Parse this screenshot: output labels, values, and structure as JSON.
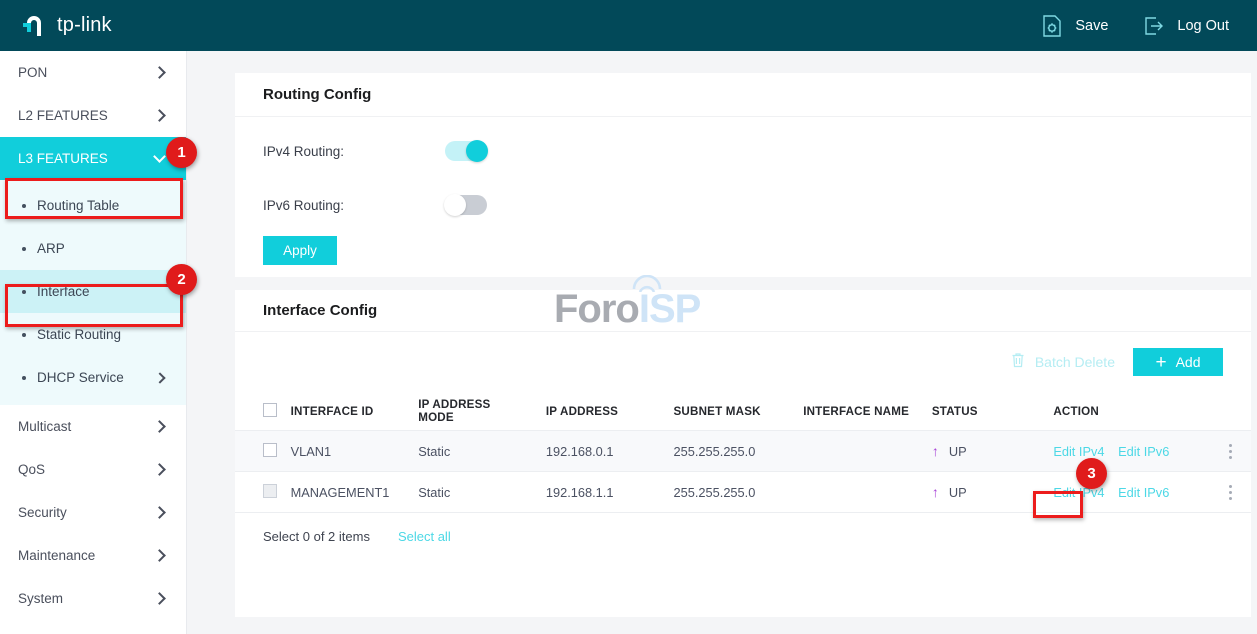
{
  "header": {
    "brand": "tp-link",
    "brand_icon": "tplink-logo-icon",
    "save_label": "Save",
    "save_icon": "save-gear-document-icon",
    "logout_label": "Log Out",
    "logout_icon": "logout-arrow-icon"
  },
  "sidebar": {
    "items": [
      {
        "label": "PON",
        "icon": "chevron-right-icon",
        "state": "collapsed"
      },
      {
        "label": "L2 FEATURES",
        "icon": "chevron-right-icon",
        "state": "collapsed"
      },
      {
        "label": "L3 FEATURES",
        "icon": "chevron-down-icon",
        "state": "expanded"
      }
    ],
    "submenu": [
      {
        "label": "Routing Table",
        "selected": false,
        "expandable": false
      },
      {
        "label": "ARP",
        "selected": false,
        "expandable": false
      },
      {
        "label": "Interface",
        "selected": true,
        "expandable": false
      },
      {
        "label": "Static Routing",
        "selected": false,
        "expandable": false
      },
      {
        "label": "DHCP Service",
        "selected": false,
        "expandable": true
      }
    ],
    "items_after": [
      {
        "label": "Multicast",
        "icon": "chevron-right-icon"
      },
      {
        "label": "QoS",
        "icon": "chevron-right-icon"
      },
      {
        "label": "Security",
        "icon": "chevron-right-icon"
      },
      {
        "label": "Maintenance",
        "icon": "chevron-right-icon"
      },
      {
        "label": "System",
        "icon": "chevron-right-icon"
      }
    ]
  },
  "routing_config": {
    "title": "Routing Config",
    "ipv4_label": "IPv4 Routing:",
    "ipv4_state": "on",
    "ipv6_label": "IPv6 Routing:",
    "ipv6_state": "off",
    "apply_label": "Apply"
  },
  "interface_config": {
    "title": "Interface Config",
    "batch_delete_label": "Batch Delete",
    "batch_delete_icon": "trash-icon",
    "batch_delete_disabled": true,
    "add_label": "Add",
    "add_icon": "plus-icon",
    "columns": [
      "INTERFACE ID",
      "IP ADDRESS MODE",
      "IP ADDRESS",
      "SUBNET MASK",
      "INTERFACE NAME",
      "STATUS",
      "ACTION"
    ],
    "rows": [
      {
        "checked": false,
        "checkbox_disabled": false,
        "interface_id": "VLAN1",
        "ip_address_mode": "Static",
        "ip_address": "192.168.0.1",
        "subnet_mask": "255.255.255.0",
        "interface_name": "",
        "status": "UP",
        "status_icon": "arrow-up-icon",
        "edit_ipv4": "Edit IPv4",
        "edit_ipv6": "Edit IPv6",
        "menu_icon": "kebab-menu-icon"
      },
      {
        "checked": false,
        "checkbox_disabled": true,
        "interface_id": "MANAGEMENT1",
        "ip_address_mode": "Static",
        "ip_address": "192.168.1.1",
        "subnet_mask": "255.255.255.0",
        "interface_name": "",
        "status": "UP",
        "status_icon": "arrow-up-icon",
        "edit_ipv4": "Edit IPv4",
        "edit_ipv6": "Edit IPv6",
        "menu_icon": "kebab-menu-icon"
      }
    ],
    "footer_status": "Select 0 of 2 items",
    "select_all_label": "Select all"
  },
  "watermark": {
    "part1": "Foro",
    "part2": "ISP"
  },
  "annotations": [
    {
      "number": "1",
      "target": "sidebar-item-l3-features"
    },
    {
      "number": "2",
      "target": "sidebar-subitem-interface"
    },
    {
      "number": "3",
      "target": "edit-ipv4-link-row-2"
    }
  ],
  "colors": {
    "header_bg": "#024959",
    "accent": "#11cedb",
    "link": "#4cd8e6",
    "submenu_bg": "#eefafc",
    "selected_bg": "#ccf2f6",
    "status_up": "#a843d6",
    "annotation_red": "#e01b1b"
  }
}
